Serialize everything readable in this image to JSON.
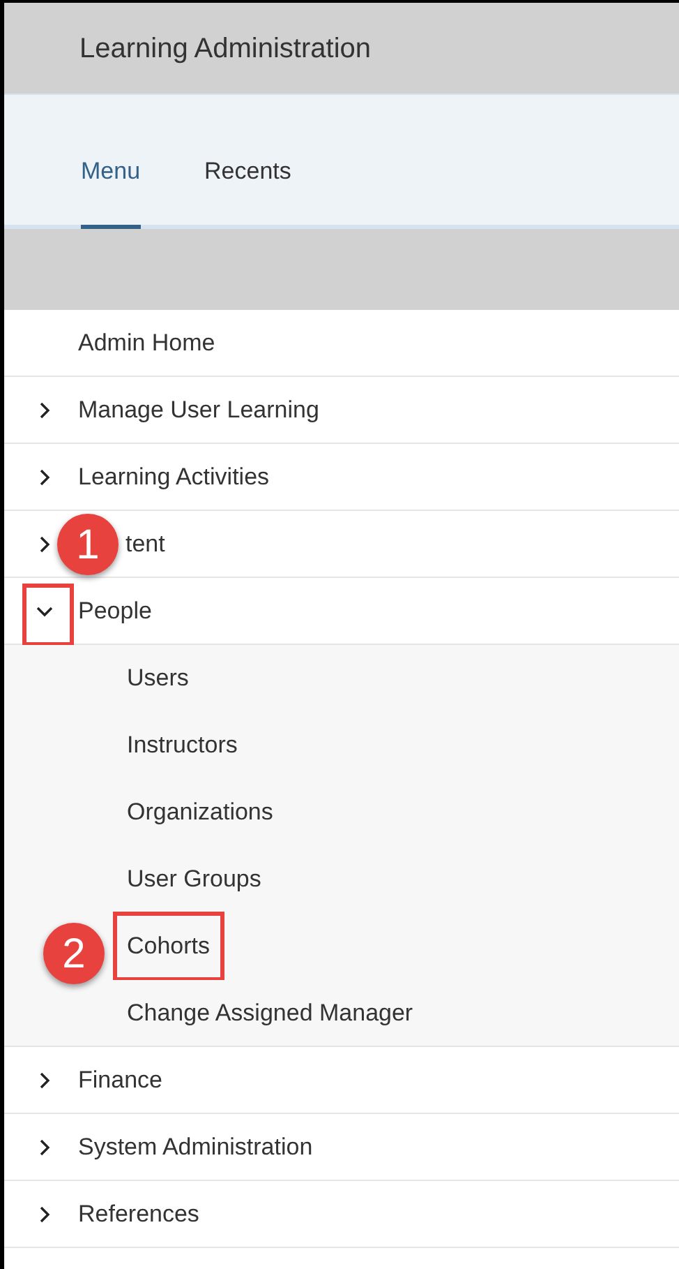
{
  "header": {
    "title": "Learning Administration"
  },
  "tabs": [
    {
      "label": "Menu",
      "selected": true
    },
    {
      "label": "Recents",
      "selected": false
    }
  ],
  "menu": [
    {
      "kind": "link",
      "label": "Admin Home"
    },
    {
      "kind": "group",
      "label": "Manage User Learning",
      "expanded": false
    },
    {
      "kind": "group",
      "label": "Learning Activities",
      "expanded": false
    },
    {
      "kind": "group",
      "label": "tent",
      "expanded": false,
      "callout": "1"
    },
    {
      "kind": "group",
      "label": "People",
      "expanded": true,
      "highlighted": true,
      "children": [
        {
          "label": "Users"
        },
        {
          "label": "Instructors"
        },
        {
          "label": "Organizations"
        },
        {
          "label": "User Groups"
        },
        {
          "label": "Cohorts",
          "highlighted": true,
          "callout": "2"
        },
        {
          "label": "Change Assigned Manager"
        }
      ]
    },
    {
      "kind": "group",
      "label": "Finance",
      "expanded": false
    },
    {
      "kind": "group",
      "label": "System Administration",
      "expanded": false
    },
    {
      "kind": "group",
      "label": "References",
      "expanded": false
    }
  ]
}
